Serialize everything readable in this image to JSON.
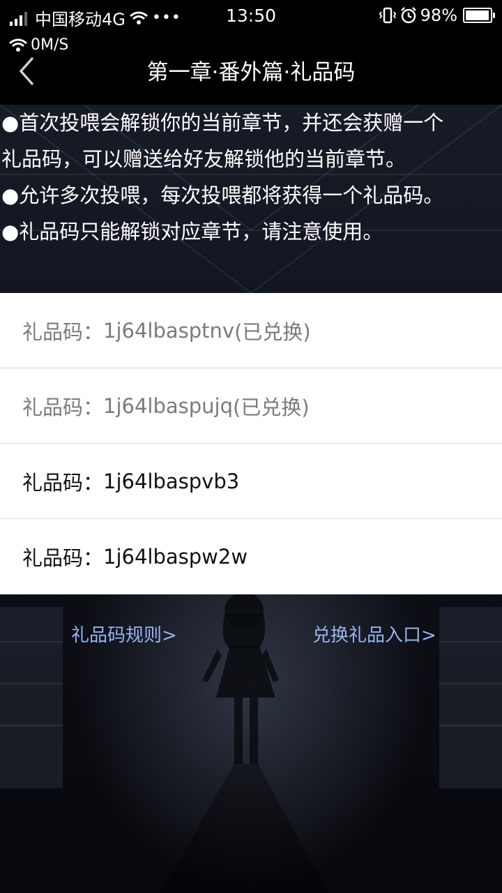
{
  "status_bar": {
    "carrier": "中国移动4G",
    "more": "•••",
    "time": "13:50",
    "battery_text": "98%",
    "battery_level": 0.98,
    "net_speed": "0M/S"
  },
  "nav": {
    "title": "第一章·番外篇·礼品码"
  },
  "intro": {
    "lines": [
      "●首次投喂会解锁你的当前章节，并还会获赠一个",
      "礼品码，可以赠送给好友解锁他的当前章节。",
      "●允许多次投喂，每次投喂都将获得一个礼品码。",
      "●礼品码只能解锁对应章节，请注意使用。"
    ]
  },
  "codes": [
    {
      "label": "礼品码：",
      "code": "1j64lbasptnv",
      "status": "(已兑换)"
    },
    {
      "label": "礼品码：",
      "code": "1j64lbaspujq",
      "status": "(已兑换)"
    },
    {
      "label": "礼品码：",
      "code": "1j64lbaspvb3",
      "status": ""
    },
    {
      "label": "礼品码：",
      "code": "1j64lbaspw2w",
      "status": ""
    }
  ],
  "links": {
    "rules": "礼品码规则>",
    "redeem": "兑换礼品入口>"
  }
}
